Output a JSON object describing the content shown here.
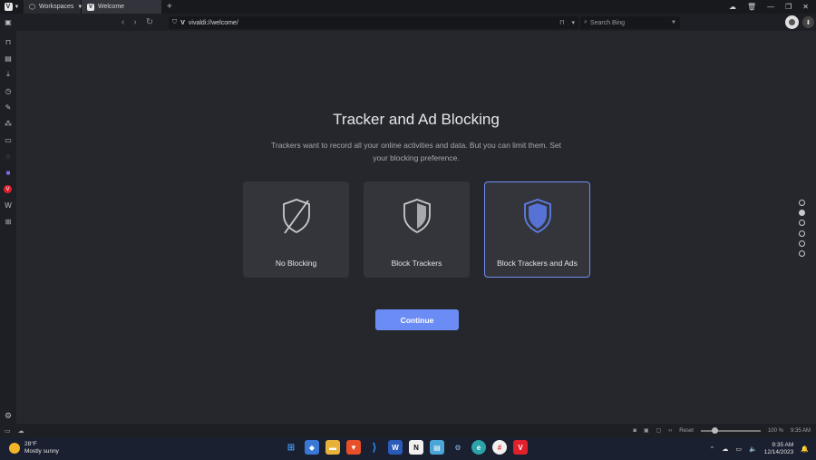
{
  "tabs": {
    "workspaces_label": "Workspaces",
    "active_tab_label": "Welcome",
    "new_tab": "+"
  },
  "address": {
    "url": "vivaldi://welcome/",
    "search_placeholder": "Search Bing"
  },
  "onboarding": {
    "title": "Tracker and Ad Blocking",
    "subtitle": "Trackers want to record all your online activities and data. But you can limit them. Set your blocking preference.",
    "options": [
      {
        "label": "No Blocking",
        "selected": false
      },
      {
        "label": "Block Trackers",
        "selected": false
      },
      {
        "label": "Block Trackers and Ads",
        "selected": true
      }
    ],
    "continue_label": "Continue",
    "steps_total": 6,
    "current_step": 2
  },
  "statusbar": {
    "reset_label": "Reset",
    "zoom_label": "100 %",
    "time": "9:35 AM"
  },
  "taskbar": {
    "temperature": "28°F",
    "weather": "Mostly sunny",
    "clock_time": "9:35 AM",
    "clock_date": "12/14/2023"
  },
  "colors": {
    "accent": "#6b8cf5",
    "background": "#26272d",
    "card": "#34353b"
  }
}
